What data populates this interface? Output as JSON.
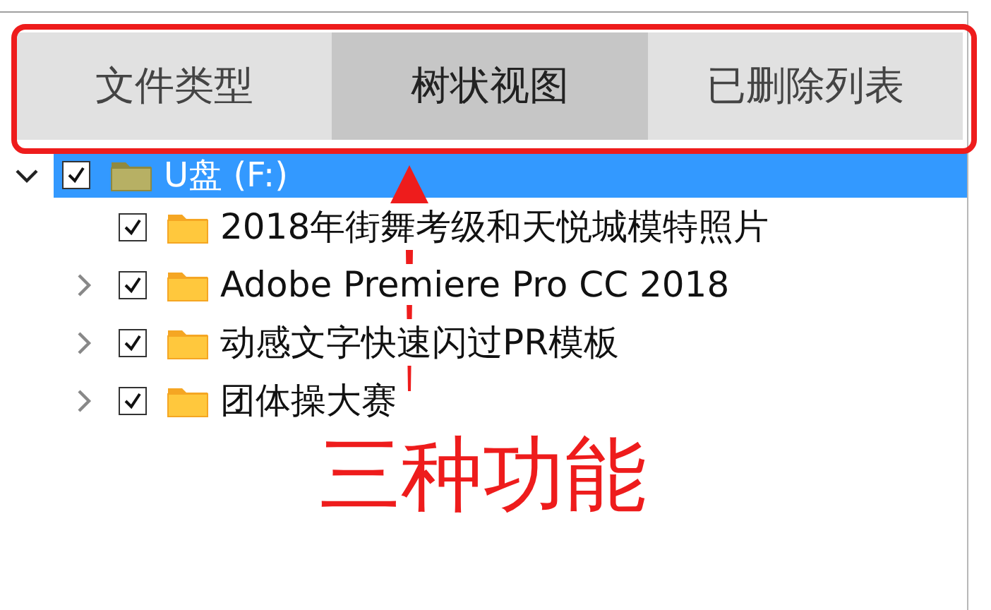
{
  "tabs": [
    {
      "label": "文件类型",
      "selected": false
    },
    {
      "label": "树状视图",
      "selected": true
    },
    {
      "label": "已删除列表",
      "selected": false
    }
  ],
  "tree": {
    "label": "U盘 (F:)",
    "checked": true,
    "selected": true,
    "expanded": true,
    "children": [
      {
        "label": "2018年街舞考级和天悦城模特照片",
        "checked": true,
        "selected": false
      },
      {
        "label": "Adobe Premiere Pro CC 2018",
        "checked": true,
        "selected": false,
        "expanded": false
      },
      {
        "label": "动感文字快速闪过PR模板",
        "checked": true,
        "selected": false,
        "expanded": false
      },
      {
        "label": "团体操大赛",
        "checked": true,
        "selected": false,
        "expanded": false
      }
    ]
  },
  "annotation": {
    "caption": "三种功能"
  }
}
